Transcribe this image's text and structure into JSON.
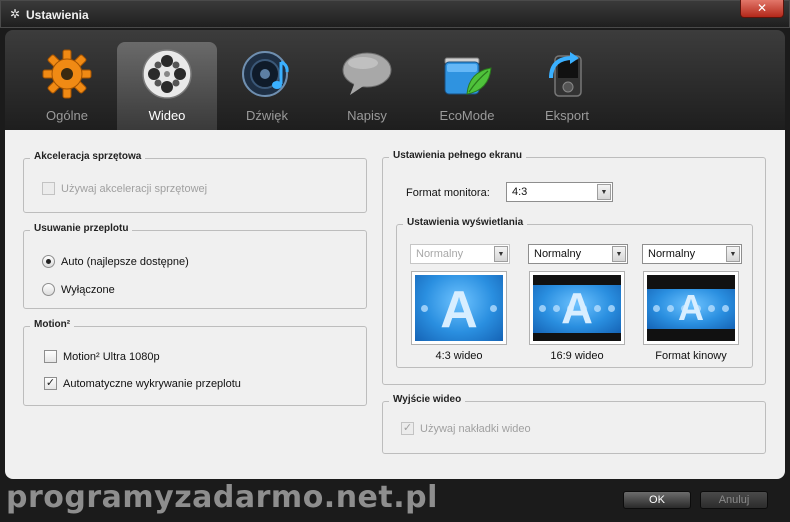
{
  "window": {
    "title": "Ustawienia",
    "close_glyph": "✕"
  },
  "tabs": [
    {
      "label": "Ogólne",
      "icon": "gear-icon",
      "active": false
    },
    {
      "label": "Wideo",
      "icon": "film-reel-icon",
      "active": true
    },
    {
      "label": "Dźwięk",
      "icon": "speaker-note-icon",
      "active": false
    },
    {
      "label": "Napisy",
      "icon": "speech-bubble-icon",
      "active": false
    },
    {
      "label": "EcoMode",
      "icon": "battery-leaf-icon",
      "active": false
    },
    {
      "label": "Eksport",
      "icon": "device-export-icon",
      "active": false
    }
  ],
  "hw_accel": {
    "title": "Akceleracja sprzętowa",
    "checkbox_label": "Używaj akceleracji sprzętowej",
    "checked": false,
    "enabled": false
  },
  "deinterlace": {
    "title": "Usuwanie przeplotu",
    "options": [
      {
        "label": "Auto (najlepsze dostępne)",
        "selected": true
      },
      {
        "label": "Wyłączone",
        "selected": false
      }
    ]
  },
  "motion": {
    "title": "Motion²",
    "items": [
      {
        "label": "Motion² Ultra 1080p",
        "checked": false
      },
      {
        "label": "Automatyczne wykrywanie przeplotu",
        "checked": true
      }
    ]
  },
  "fullscreen": {
    "title": "Ustawienia pełnego ekranu",
    "monitor_format_label": "Format monitora:",
    "monitor_format_value": "4:3",
    "display": {
      "title": "Ustawienia wyświetlania",
      "modes": [
        {
          "select_value": "Normalny",
          "enabled": false,
          "caption": "4:3 wideo",
          "preview_letter": "A"
        },
        {
          "select_value": "Normalny",
          "enabled": true,
          "caption": "16:9 wideo",
          "preview_letter": "A"
        },
        {
          "select_value": "Normalny",
          "enabled": true,
          "caption": "Format kinowy",
          "preview_letter": "A"
        }
      ]
    }
  },
  "video_output": {
    "title": "Wyjście wideo",
    "checkbox_label": "Używaj nakładki wideo",
    "checked": true,
    "enabled": false
  },
  "watermark": "programyzadarmo.net.pl",
  "buttons": {
    "ok": "OK",
    "cancel": "Anuluj"
  },
  "colors": {
    "accent_blue": "#2a8fe0",
    "close_red": "#c8392a",
    "panel_bg": "#f0f0f0",
    "dark_bg": "#1b1b1b"
  }
}
